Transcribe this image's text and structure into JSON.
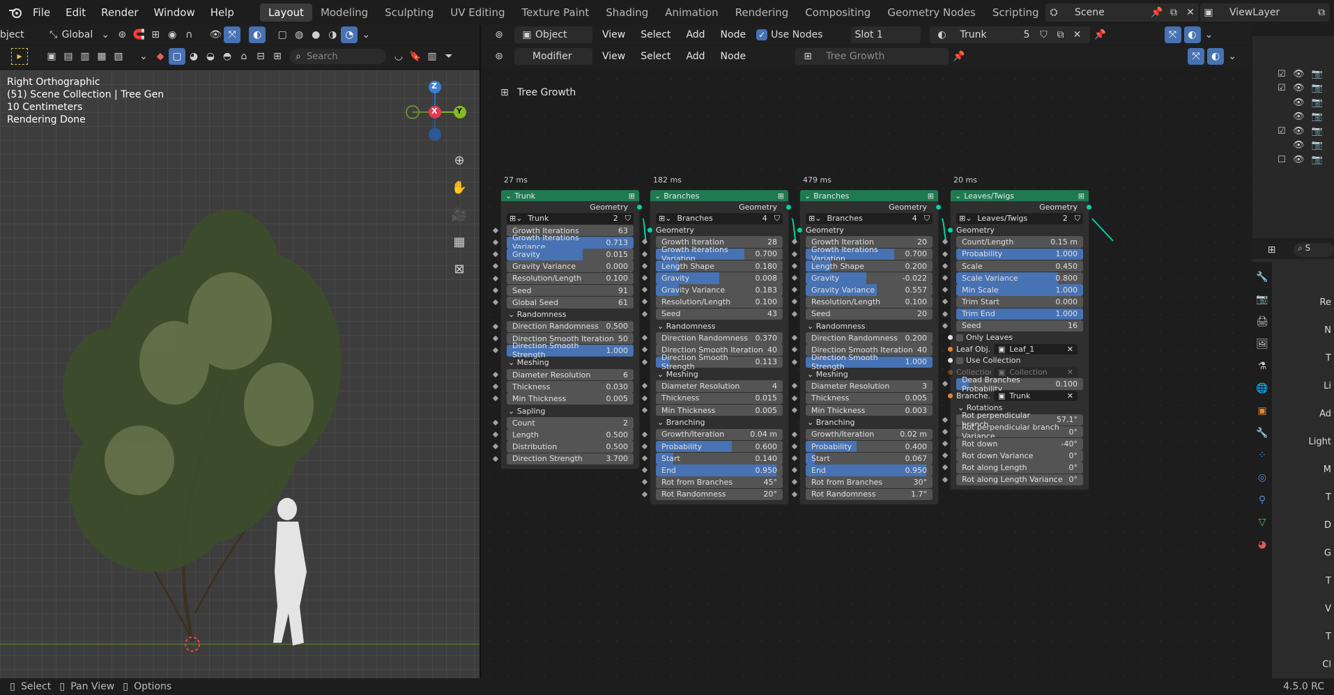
{
  "topbar": {
    "menus": [
      "File",
      "Edit",
      "Render",
      "Window",
      "Help"
    ],
    "workspaces": [
      "Layout",
      "Modeling",
      "Sculpting",
      "UV Editing",
      "Texture Paint",
      "Shading",
      "Animation",
      "Rendering",
      "Compositing",
      "Geometry Nodes",
      "Scripting"
    ],
    "add_tab": "+",
    "scene": "Scene",
    "view_layer": "ViewLayer"
  },
  "viewport_header": {
    "mode": "bject",
    "orientation": "Global",
    "search_placeholder": "Search"
  },
  "viewport_info": {
    "line1": "Right Orthographic",
    "line2": "(51) Scene Collection | Tree Gen",
    "line3": "10 Centimeters",
    "line4": "Rendering Done"
  },
  "gizmo": {
    "z": "Z",
    "x": "X",
    "y": "Y"
  },
  "node_header1": {
    "editor_type": "Object",
    "menus": [
      "View",
      "Select",
      "Add",
      "Node"
    ],
    "use_nodes": "Use Nodes",
    "slot": "Slot 1",
    "object": "Trunk",
    "users": "5"
  },
  "node_header2": {
    "type": "Modifier",
    "menus": [
      "View",
      "Select",
      "Add",
      "Node"
    ],
    "tree": "Tree Growth"
  },
  "breadcrumb": "Tree Growth",
  "nodes": [
    {
      "time": "27 ms",
      "title": "Trunk",
      "output": "Geometry",
      "data_name": "Trunk",
      "users": "2",
      "rows": [
        {
          "k": "f",
          "label": "Growth Iterations",
          "value": "63",
          "fill": 0
        },
        {
          "k": "f",
          "label": "Growth Iterations Variance",
          "value": "0.713",
          "fill": 1
        },
        {
          "k": "f",
          "label": "Gravity",
          "value": "0.015",
          "fill": 0.6
        },
        {
          "k": "f",
          "label": "Gravity Variance",
          "value": "0.000",
          "fill": 0
        },
        {
          "k": "f",
          "label": "Resolution/Length",
          "value": "0.100",
          "fill": 0
        },
        {
          "k": "f",
          "label": "Seed",
          "value": "91",
          "fill": 0
        },
        {
          "k": "f",
          "label": "Global Seed",
          "value": "61",
          "fill": 0
        },
        {
          "k": "s",
          "label": "Randomness"
        },
        {
          "k": "f",
          "label": "Direction Randomness",
          "value": "0.500",
          "fill": 0
        },
        {
          "k": "f",
          "label": "Direction Smooth Iteration",
          "value": "50",
          "fill": 0
        },
        {
          "k": "f",
          "label": "Direction Smooth Strength",
          "value": "1.000",
          "fill": 1
        },
        {
          "k": "s",
          "label": "Meshing"
        },
        {
          "k": "f",
          "label": "Diameter Resolution",
          "value": "6",
          "fill": 0
        },
        {
          "k": "f",
          "label": "Thickness",
          "value": "0.030",
          "fill": 0
        },
        {
          "k": "f",
          "label": "Min Thickness",
          "value": "0.005",
          "fill": 0
        },
        {
          "k": "s",
          "label": "Sapling"
        },
        {
          "k": "f",
          "label": "Count",
          "value": "2",
          "fill": 0
        },
        {
          "k": "f",
          "label": "Length",
          "value": "0.500",
          "fill": 0
        },
        {
          "k": "f",
          "label": "Distribution",
          "value": "0.500",
          "fill": 0
        },
        {
          "k": "f",
          "label": "Direction Strength",
          "value": "3.700",
          "fill": 0
        }
      ]
    },
    {
      "time": "182 ms",
      "title": "Branches",
      "output": "Geometry",
      "data_name": "Branches",
      "users": "4",
      "rows": [
        {
          "k": "l",
          "label": "Geometry"
        },
        {
          "k": "f",
          "label": "Growth Iteration",
          "value": "28",
          "fill": 0
        },
        {
          "k": "f",
          "label": "Growth Iterations Variation",
          "value": "0.700",
          "fill": 0.7
        },
        {
          "k": "f",
          "label": "Length Shape",
          "value": "0.180",
          "fill": 0.18
        },
        {
          "k": "f",
          "label": "Gravity",
          "value": "0.008",
          "fill": 0.5
        },
        {
          "k": "f",
          "label": "Gravity Variance",
          "value": "0.183",
          "fill": 0.18
        },
        {
          "k": "f",
          "label": "Resolution/Length",
          "value": "0.100",
          "fill": 0
        },
        {
          "k": "f",
          "label": "Seed",
          "value": "43",
          "fill": 0
        },
        {
          "k": "s",
          "label": "Randomness"
        },
        {
          "k": "f",
          "label": "Direction Randomness",
          "value": "0.370",
          "fill": 0
        },
        {
          "k": "f",
          "label": "Direction Smooth Iteration",
          "value": "40",
          "fill": 0
        },
        {
          "k": "f",
          "label": "Direction Smooth Strength",
          "value": "0.113",
          "fill": 0.11
        },
        {
          "k": "s",
          "label": "Meshing"
        },
        {
          "k": "f",
          "label": "Diameter Resolution",
          "value": "4",
          "fill": 0
        },
        {
          "k": "f",
          "label": "Thickness",
          "value": "0.015",
          "fill": 0
        },
        {
          "k": "f",
          "label": "Min Thickness",
          "value": "0.005",
          "fill": 0
        },
        {
          "k": "s",
          "label": "Branching"
        },
        {
          "k": "f",
          "label": "Growth/Iteration",
          "value": "0.04 m",
          "fill": 0
        },
        {
          "k": "f",
          "label": "Probability",
          "value": "0.600",
          "fill": 0.6
        },
        {
          "k": "f",
          "label": "Start",
          "value": "0.140",
          "fill": 0.14
        },
        {
          "k": "f",
          "label": "End",
          "value": "0.950",
          "fill": 0.95
        },
        {
          "k": "f",
          "label": "Rot from Branches",
          "value": "45°",
          "fill": 0
        },
        {
          "k": "f",
          "label": "Rot Randomness",
          "value": "20°",
          "fill": 0
        }
      ]
    },
    {
      "time": "479 ms",
      "title": "Branches",
      "output": "Geometry",
      "data_name": "Branches",
      "users": "4",
      "rows": [
        {
          "k": "l",
          "label": "Geometry"
        },
        {
          "k": "f",
          "label": "Growth Iteration",
          "value": "20",
          "fill": 0
        },
        {
          "k": "f",
          "label": "Growth Iterations Variation",
          "value": "0.700",
          "fill": 0.7
        },
        {
          "k": "f",
          "label": "Length Shape",
          "value": "0.200",
          "fill": 0.2
        },
        {
          "k": "f",
          "label": "Gravity",
          "value": "-0.022",
          "fill": 0.48
        },
        {
          "k": "f",
          "label": "Gravity Variance",
          "value": "0.557",
          "fill": 0.56
        },
        {
          "k": "f",
          "label": "Resolution/Length",
          "value": "0.100",
          "fill": 0
        },
        {
          "k": "f",
          "label": "Seed",
          "value": "20",
          "fill": 0
        },
        {
          "k": "s",
          "label": "Randomness"
        },
        {
          "k": "f",
          "label": "Direction Randomness",
          "value": "0.200",
          "fill": 0
        },
        {
          "k": "f",
          "label": "Direction Smooth Iteration",
          "value": "40",
          "fill": 0
        },
        {
          "k": "f",
          "label": "Direction Smooth Strength",
          "value": "1.000",
          "fill": 1
        },
        {
          "k": "s",
          "label": "Meshing"
        },
        {
          "k": "f",
          "label": "Diameter Resolution",
          "value": "3",
          "fill": 0
        },
        {
          "k": "f",
          "label": "Thickness",
          "value": "0.005",
          "fill": 0
        },
        {
          "k": "f",
          "label": "Min Thickness",
          "value": "0.003",
          "fill": 0
        },
        {
          "k": "s",
          "label": "Branching"
        },
        {
          "k": "f",
          "label": "Growth/Iteration",
          "value": "0.02 m",
          "fill": 0
        },
        {
          "k": "f",
          "label": "Probability",
          "value": "0.400",
          "fill": 0.4
        },
        {
          "k": "f",
          "label": "Start",
          "value": "0.067",
          "fill": 0.07
        },
        {
          "k": "f",
          "label": "End",
          "value": "0.950",
          "fill": 0.95
        },
        {
          "k": "f",
          "label": "Rot from Branches",
          "value": "30°",
          "fill": 0
        },
        {
          "k": "f",
          "label": "Rot Randomness",
          "value": "1.7°",
          "fill": 0
        }
      ]
    },
    {
      "time": "20 ms",
      "title": "Leaves/Twigs",
      "output": "Geometry",
      "data_name": "Leaves/Twigs",
      "users": "2",
      "rows": [
        {
          "k": "l",
          "label": "Geometry"
        },
        {
          "k": "f",
          "label": "Count/Length",
          "value": "0.15 m",
          "fill": 0
        },
        {
          "k": "f",
          "label": "Probability",
          "value": "1.000",
          "fill": 1
        },
        {
          "k": "f",
          "label": "Scale",
          "value": "0.450",
          "fill": 0
        },
        {
          "k": "f",
          "label": "Scale Variance",
          "value": "0.800",
          "fill": 0.8
        },
        {
          "k": "f",
          "label": "Min Scale",
          "value": "1.000",
          "fill": 1
        },
        {
          "k": "f",
          "label": "Trim Start",
          "value": "0.000",
          "fill": 0
        },
        {
          "k": "f",
          "label": "Trim End",
          "value": "1.000",
          "fill": 1
        },
        {
          "k": "f",
          "label": "Seed",
          "value": "16",
          "fill": 0
        },
        {
          "k": "c",
          "label": "Only Leaves"
        },
        {
          "k": "o",
          "label": "Leaf Obj...",
          "value": "Leaf_1"
        },
        {
          "k": "c",
          "label": "Use Collection"
        },
        {
          "k": "o",
          "label": "Collection:",
          "value": "Collection",
          "dim": true
        },
        {
          "k": "f",
          "label": "Dead Branches Probability",
          "value": "0.100",
          "fill": 0.1
        },
        {
          "k": "o",
          "label": "Branche...",
          "value": "Trunk"
        },
        {
          "k": "s",
          "label": "Rotations"
        },
        {
          "k": "f",
          "label": "Rot perpendicular branch",
          "value": "57.1°",
          "fill": 0
        },
        {
          "k": "f",
          "label": "Rot perpendicular branch Variance",
          "value": "0°",
          "fill": 0
        },
        {
          "k": "f",
          "label": "Rot down",
          "value": "-40°",
          "fill": 0
        },
        {
          "k": "f",
          "label": "Rot down Variance",
          "value": "0°",
          "fill": 0
        },
        {
          "k": "f",
          "label": "Rot along Length",
          "value": "0°",
          "fill": 0
        },
        {
          "k": "f",
          "label": "Rot along Length Variance",
          "value": "0°",
          "fill": 0
        }
      ]
    }
  ],
  "properties_labels": [
    "Re",
    "N",
    "T",
    "Li",
    "Ad",
    "Light",
    "M",
    "T",
    "D",
    "G",
    "T",
    "V",
    "T",
    "Cl"
  ],
  "statusbar": {
    "select": "Select",
    "pan": "Pan View",
    "options": "Options",
    "version": "4.5.0 RC"
  },
  "colors": {
    "accent": "#4772b3",
    "node_header": "#1f7a52",
    "geometry_socket": "#00d6a3"
  }
}
